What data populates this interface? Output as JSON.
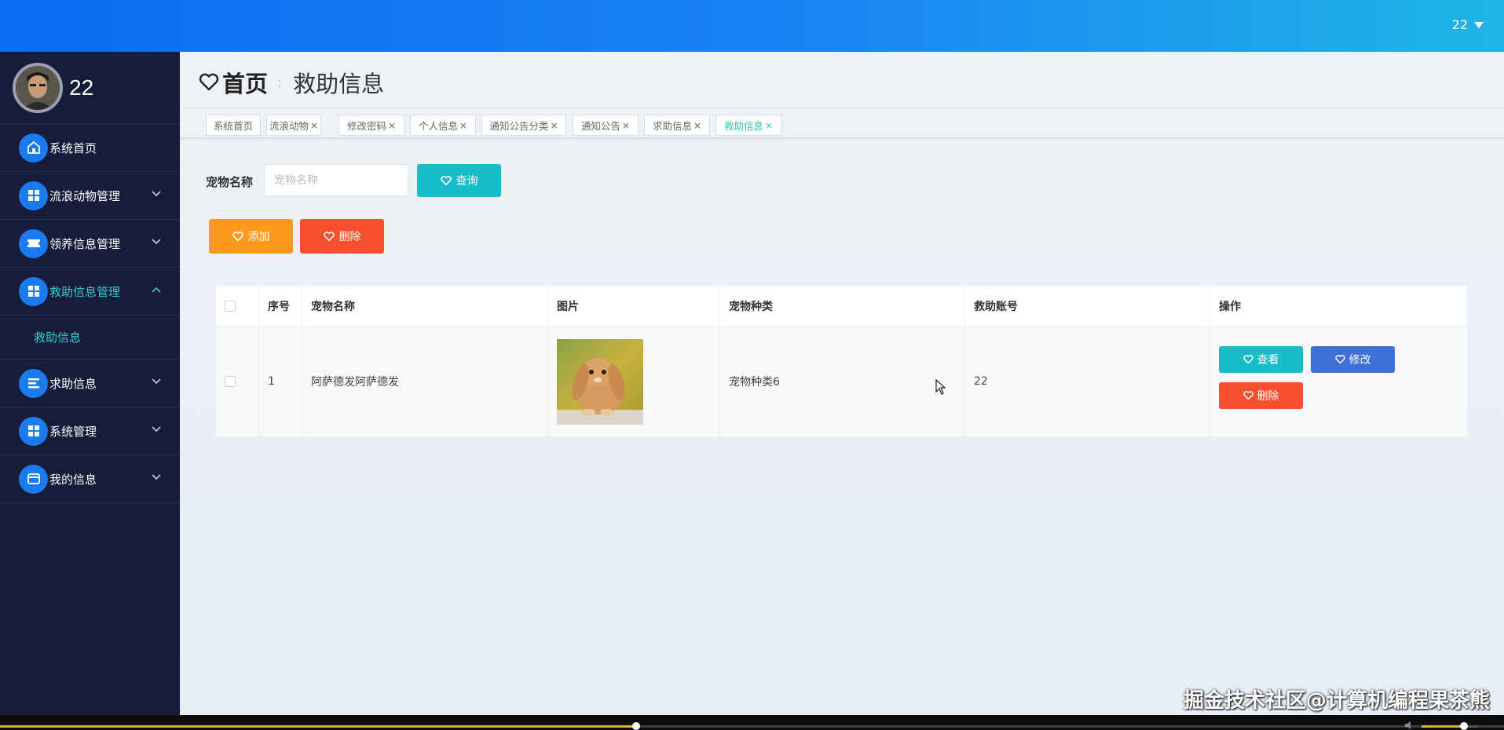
{
  "topbar": {
    "username": "22"
  },
  "sidebar": {
    "profile_name": "22",
    "items": [
      {
        "label": "系统首页",
        "icon": "home-icon"
      },
      {
        "label": "流浪动物管理",
        "icon": "grid-icon"
      },
      {
        "label": "领养信息管理",
        "icon": "ticket-icon"
      },
      {
        "label": "救助信息管理",
        "icon": "grid-icon"
      },
      {
        "label": "求助信息",
        "icon": "list-icon"
      },
      {
        "label": "系统管理",
        "icon": "grid-icon"
      },
      {
        "label": "我的信息",
        "icon": "card-icon"
      }
    ],
    "submenu": {
      "label": "救助信息"
    }
  },
  "breadcrumb": {
    "home": "首页",
    "current": "救助信息"
  },
  "tabs": [
    "系统首页",
    "流浪动物",
    "修改密码",
    "个人信息",
    "通知公告分类",
    "通知公告",
    "求助信息",
    "救助信息"
  ],
  "search": {
    "label": "宠物名称",
    "placeholder": "宠物名称",
    "button": "查询"
  },
  "actions": {
    "add": "添加",
    "delete": "删除"
  },
  "table": {
    "columns": [
      "序号",
      "宠物名称",
      "图片",
      "宠物种类",
      "救助账号",
      "操作"
    ],
    "rows": [
      {
        "index": "1",
        "pet_name": "阿萨德发阿萨德发",
        "pet_type": "宠物种类6",
        "account": "22"
      }
    ],
    "row_buttons": {
      "view": "查看",
      "edit": "修改",
      "delete": "删除"
    }
  },
  "watermark": "掘金技术社区@计算机编程果茶熊",
  "colors": {
    "accent": "#17bec8",
    "warning": "#fd9a1e",
    "danger": "#f74e2d",
    "primary": "#3f6fd9",
    "sidebar_bg": "#161c3a"
  },
  "player": {
    "progress": 0.423,
    "volume": 0.75
  }
}
